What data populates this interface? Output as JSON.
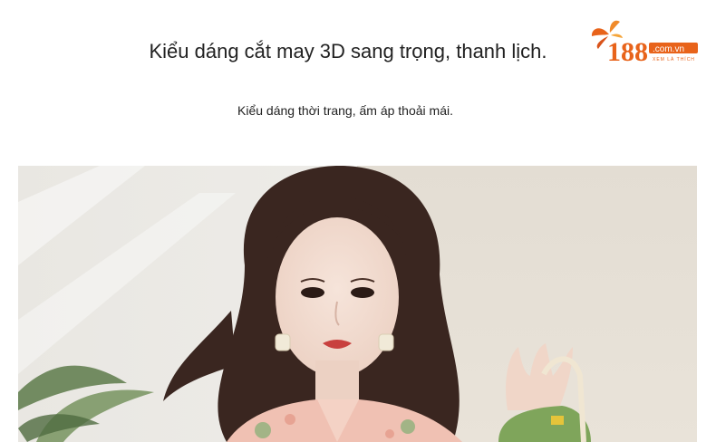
{
  "headline": "Kiểu dáng cắt may 3D sang trọng, thanh lịch.",
  "subline": "Kiểu dáng thời trang, ấm áp thoải mái.",
  "logo": {
    "number": "188",
    "domain": ".com.vn",
    "tagline": "XEM LÀ THÍCH",
    "icon": "orange-leaf-icon",
    "brand_color": "#e8631a"
  },
  "photo": {
    "icon": "product-photo"
  }
}
